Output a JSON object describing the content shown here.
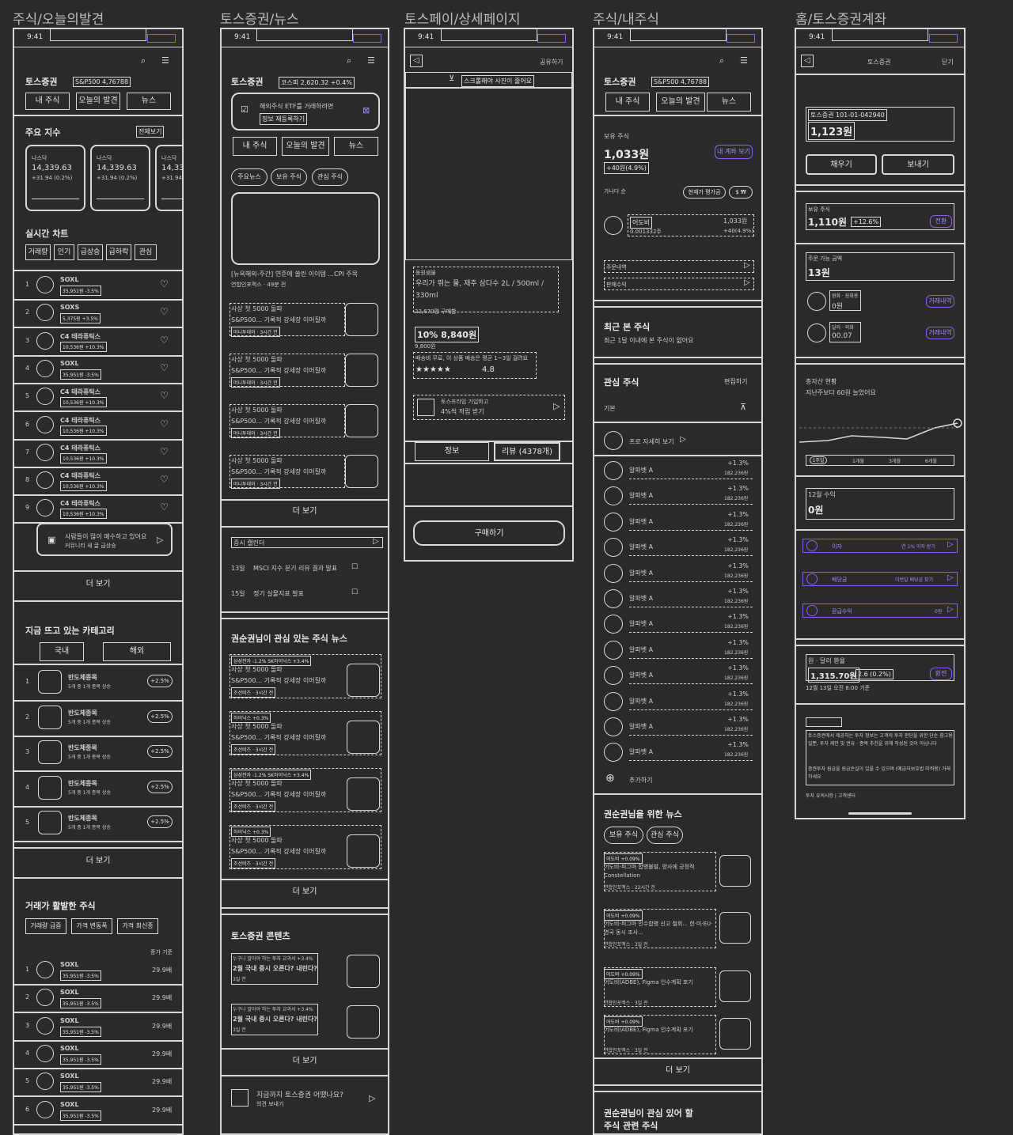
{
  "frames": {
    "discover": "주식/오늘의발견",
    "news": "토스증권/뉴스",
    "pay": "토스페이/상세페이지",
    "mystock": "주식/내주식",
    "account": "홈/토스증권계좌"
  },
  "status_time": "9:41",
  "common": {
    "brand": "토스증권",
    "sp500": "S&P500 4,76788",
    "tab_mine": "내 주식",
    "tab_discover": "오늘의 발견",
    "tab_news": "뉴스",
    "more": "더 보기"
  },
  "discover": {
    "index_title": "주요 지수",
    "index_all": "전체보기",
    "indices": [
      {
        "name": "나스닥",
        "value": "14,339.63",
        "change": "+31.94 (0.2%)"
      },
      {
        "name": "나스닥",
        "value": "14,339.63",
        "change": "+31.94 (0.2%)"
      },
      {
        "name": "나스닥",
        "value": "14,339.63",
        "change": "+31.94 (0.2%)"
      }
    ],
    "realtime_title": "실시간 차트",
    "filters": [
      "거래량",
      "인기",
      "급상승",
      "급하락",
      "관심"
    ],
    "rank": [
      {
        "n": "1",
        "name": "SOXL",
        "sub": "35,951원 -3.5%"
      },
      {
        "n": "2",
        "name": "SOXS",
        "sub": "5,375원 +3.5%"
      },
      {
        "n": "3",
        "name": "C4 테라퓨틱스",
        "sub": "10,536원 +10.3%"
      },
      {
        "n": "4",
        "name": "SOXL",
        "sub": "35,951원 -3.5%"
      },
      {
        "n": "5",
        "name": "C4 테라퓨틱스",
        "sub": "10,536원 +10.3%"
      },
      {
        "n": "6",
        "name": "C4 테라퓨틱스",
        "sub": "10,536원 +10.3%"
      },
      {
        "n": "7",
        "name": "C4 테라퓨틱스",
        "sub": "10,536원 +10.3%"
      },
      {
        "n": "8",
        "name": "C4 테라퓨틱스",
        "sub": "10,536원 +10.3%"
      },
      {
        "n": "9",
        "name": "C4 테라퓨틱스",
        "sub": "10,536원 +10.3%"
      }
    ],
    "banner_title": "사람들이 많이 매수하고 있어요",
    "banner_sub": "커뮤니티 새 글 급상승",
    "category_title": "지금 뜨고 있는 카테고리",
    "cat_tabs": [
      "국내",
      "해외"
    ],
    "categories": [
      {
        "n": "1",
        "name": "반도체종목",
        "sub": "5개 중 1개 종목 상승",
        "rate": "+2.5%"
      },
      {
        "n": "2",
        "name": "반도체종목",
        "sub": "5개 중 1개 종목 상승",
        "rate": "+2.5%"
      },
      {
        "n": "3",
        "name": "반도체종목",
        "sub": "5개 중 1개 종목 상승",
        "rate": "+2.5%"
      },
      {
        "n": "4",
        "name": "반도체종목",
        "sub": "5개 중 1개 종목 상승",
        "rate": "+2.5%"
      },
      {
        "n": "5",
        "name": "반도체종목",
        "sub": "5개 중 1개 종목 상승",
        "rate": "+2.5%"
      }
    ],
    "active_title": "거래가 활발한 주식",
    "active_filters": [
      "거래량 급증",
      "가격 변동폭",
      "가격 최신종"
    ],
    "active_col": "종가 기준",
    "active": [
      {
        "n": "1",
        "name": "SOXL",
        "sub": "35,951원 -3.5%",
        "val": "29.9배"
      },
      {
        "n": "2",
        "name": "SOXL",
        "sub": "35,951원 -3.5%",
        "val": "29.9배"
      },
      {
        "n": "3",
        "name": "SOXL",
        "sub": "35,951원 -3.5%",
        "val": "29.9배"
      },
      {
        "n": "4",
        "name": "SOXL",
        "sub": "35,951원 -3.5%",
        "val": "29.9배"
      },
      {
        "n": "5",
        "name": "SOXL",
        "sub": "35,951원 -3.5%",
        "val": "29.9배"
      },
      {
        "n": "6",
        "name": "SOXL",
        "sub": "35,951원 -3.5%",
        "val": "29.9배"
      }
    ]
  },
  "news": {
    "kospi": "코스피 2,620.32 +0.4%",
    "promo_title": "해외주식 ETF를 거래하려면",
    "promo_sub": "정보 재등록하기",
    "chips": [
      "주요뉴스",
      "보유 주식",
      "관심 주식"
    ],
    "headline": "[뉴욕해외-주간] 연준에 쏠린 이이템 ...CPI 주목",
    "headline_sub": "연합인포맥스 · 49분 전",
    "items": [
      {
        "title": "사상 첫 5000 돌파",
        "body": "S&P500... 기록적 강세장 이어질까",
        "meta": "머니투데이 · 3시간 전"
      },
      {
        "title": "사상 첫 5000 돌파",
        "body": "S&P500... 기록적 강세장 이어질까",
        "meta": "머니투데이 · 3시간 전"
      },
      {
        "title": "사상 첫 5000 돌파",
        "body": "S&P500... 기록적 강세장 이어질까",
        "meta": "머니투데이 · 3시간 전"
      },
      {
        "title": "사상 첫 5000 돌파",
        "body": "S&P500... 기록적 강세장 이어질까",
        "meta": "머니투데이 · 3시간 전"
      }
    ],
    "calendar_title": "증시 캘린더",
    "cal": [
      {
        "day": "13일",
        "text": "MSCI 지수 분기 리뷰 결과 발표"
      },
      {
        "day": "15일",
        "text": "정기 실물지표 발표"
      }
    ],
    "foryou_title": "권순권님이 관심 있는 주식 뉴스",
    "foryou": [
      {
        "tag": "삼성전자 -1.2%  SK하이닉스 +3.4%",
        "title": "사상 첫 5000 돌파",
        "body": "S&P500... 기록적 강세장 이어질까",
        "meta": "조선비즈 · 3시간 전"
      },
      {
        "tag": "하이닉스 +0.3%",
        "title": "사상 첫 5000 돌파",
        "body": "S&P500... 기록적 강세장 이어질까",
        "meta": "조선비즈 · 3시간 전"
      },
      {
        "tag": "삼성전자 -1.2%  SK하이닉스 +3.4%",
        "title": "사상 첫 5000 돌파",
        "body": "S&P500... 기록적 강세장 이어질까",
        "meta": "조선비즈 · 3시간 전"
      },
      {
        "tag": "하이닉스 +0.3%",
        "title": "사상 첫 5000 돌파",
        "body": "S&P500... 기록적 강세장 이어질까",
        "meta": "조선비즈 · 3시간 전"
      }
    ],
    "contents_title": "토스증권 콘텐츠",
    "contents": [
      {
        "tag": "누구나 알아야 하는 투자 교과서 +3.4%",
        "title": "2월 국내 증시 오른다? 내린다?",
        "meta": "3일 전"
      },
      {
        "tag": "누구나 알아야 하는 투자 교과서 +3.4%",
        "title": "2월 국내 증시 오른다? 내린다?",
        "meta": "3일 전"
      }
    ],
    "survey_title": "지금까지 토스증권 어땠나요?",
    "survey_sub": "의견 보내기"
  },
  "pay": {
    "share": "공유하기",
    "scroll_hint": "스크롤해야 사진이 줄어요",
    "seller": "동원샘물",
    "product": "우리가 뛰는 물, 제주 삼다수 2L / 500ml / 330ml",
    "reviews_count": "23,670명 구매함",
    "discount": "10% 8,840원",
    "orig_price": "9,800원",
    "delivery": "배송비 무료, 이 상품 배송은 평균 1~3일 걸려요",
    "stars": "★★★★★",
    "rating": "4.8",
    "membership": "토스프라임 가입하고",
    "membership_sub": "4%씩 적립 받기",
    "tab_info": "정보",
    "tab_review": "리뷰 (4378개)",
    "buy": "구매하기"
  },
  "mystock": {
    "holding_label": "보유 주식",
    "amount": "1,033원",
    "profit": "+40원(4.9%)",
    "my_account_btn": "내 계좌 보기",
    "sort": "가나다 순",
    "view_opts": [
      "현재가",
      "평가금"
    ],
    "stock_name": "어도비",
    "stock_sub": "0.001332주",
    "stock_amount": "1,033원",
    "stock_profit": "+40(4.9%)",
    "order_history": "주문내역",
    "dividend": "판매수익",
    "recent_title": "최근 본 주식",
    "recent_empty": "최근 1달 이내에 본 주식이 없어요",
    "watch_title": "관심 주식",
    "watch_edit": "편집하기",
    "watch_group": "기본",
    "detail_view": "프로 자세히 보기",
    "watch_items": [
      {
        "name": "알파벳 A",
        "rate": "+1.3%",
        "price": "182,236원"
      },
      {
        "name": "알파벳 A",
        "rate": "+1.3%",
        "price": "182,236원"
      },
      {
        "name": "알파벳 A",
        "rate": "+1.3%",
        "price": "182,236원"
      },
      {
        "name": "알파벳 A",
        "rate": "+1.3%",
        "price": "182,236원"
      },
      {
        "name": "알파벳 A",
        "rate": "+1.3%",
        "price": "182,236원"
      },
      {
        "name": "알파벳 A",
        "rate": "+1.3%",
        "price": "182,236원"
      },
      {
        "name": "알파벳 A",
        "rate": "+1.3%",
        "price": "182,236원"
      },
      {
        "name": "알파벳 A",
        "rate": "+1.3%",
        "price": "182,236원"
      },
      {
        "name": "알파벳 A",
        "rate": "+1.3%",
        "price": "182,236원"
      },
      {
        "name": "알파벳 A",
        "rate": "+1.3%",
        "price": "182,236원"
      },
      {
        "name": "알파벳 A",
        "rate": "+1.3%",
        "price": "182,236원"
      },
      {
        "name": "알파벳 A",
        "rate": "+1.3%",
        "price": "182,236원"
      }
    ],
    "add": "추가하기",
    "news_title": "권순권님을 위한 뉴스",
    "news_chips": [
      "보유 주식",
      "관심 주식"
    ],
    "news": [
      {
        "tag": "어도비 +0.09%",
        "title": "어도비-피그마 합병불발, 양사에 긍정적 Constellation",
        "meta": "연합인포맥스 · 22시간 전"
      },
      {
        "tag": "어도비 +0.09%",
        "title": "어도비-피그마 인수합병 신고 철회... 한·미·EU·영국 동시 조사...",
        "meta": "연합인포맥스 · 3일 전"
      },
      {
        "tag": "어도비 +0.09%",
        "title": "어도비(ADBE), Figma 인수계획 포기",
        "meta": "연합인포맥스 · 3일 전"
      },
      {
        "tag": "어도비 +0.09%",
        "title": "어도비(ADBE), Figma 인수계획 포기",
        "meta": "연합인포맥스 · 3일 전"
      }
    ],
    "bottom_title": "권순권님이 관심 있어 할",
    "bottom_sub": "주식 관련 주식"
  },
  "account": {
    "header": "토스증권",
    "close": "닫기",
    "account_no": "토스증권 101-01-042940",
    "balance": "1,123원",
    "fill": "채우기",
    "send": "보내기",
    "holding": "보유 주식",
    "holding_amount": "1,110원",
    "holding_rate": "+12.6%",
    "holding_btn": "전환",
    "orderable": "주문 가능 금액",
    "orderable_amount": "13원",
    "krw_label": "원화 · 원화용",
    "krw_amount": "0원",
    "krw_btn": "거래내역",
    "usd_label": "달러 · 외화",
    "usd_amount": "00.07",
    "usd_btn": "거래내역",
    "asset_title": "총자산 현황",
    "asset_sub": "지난주보다 60원 늘었어요",
    "periods": [
      "1주일",
      "1개월",
      "3개월",
      "6개월"
    ],
    "month_title": "12월 수익",
    "month_amount": "0원",
    "interest": "이자",
    "interest_btn": "연 1% 이자 받기",
    "dividend": "배당금",
    "dividend_btn": "이번달 배당금 찾기",
    "rebate": "환급수익",
    "rebate_btn": "0원",
    "fx_title": "원 · 달러 환율",
    "fx_value": "1,315.70원",
    "fx_change": "2.6 (0.2%)",
    "fx_btn": "환전",
    "fx_time": "12월 13일 오전 8:00 기준",
    "legal": "토스증권에서 제공하는 투자 정보는 고객의 투자 판단을 위한 단순 참고용일뿐, 투자 제안 및 권유 · 종목 추천을 위해 작성된 것이 아닙니다",
    "legal2": "증권투자 원금을 원금손실이 있을 수 있으며 (예금자보호법 미적용) 거래하세요",
    "links": "투자 유의사항  |  고객센터"
  }
}
